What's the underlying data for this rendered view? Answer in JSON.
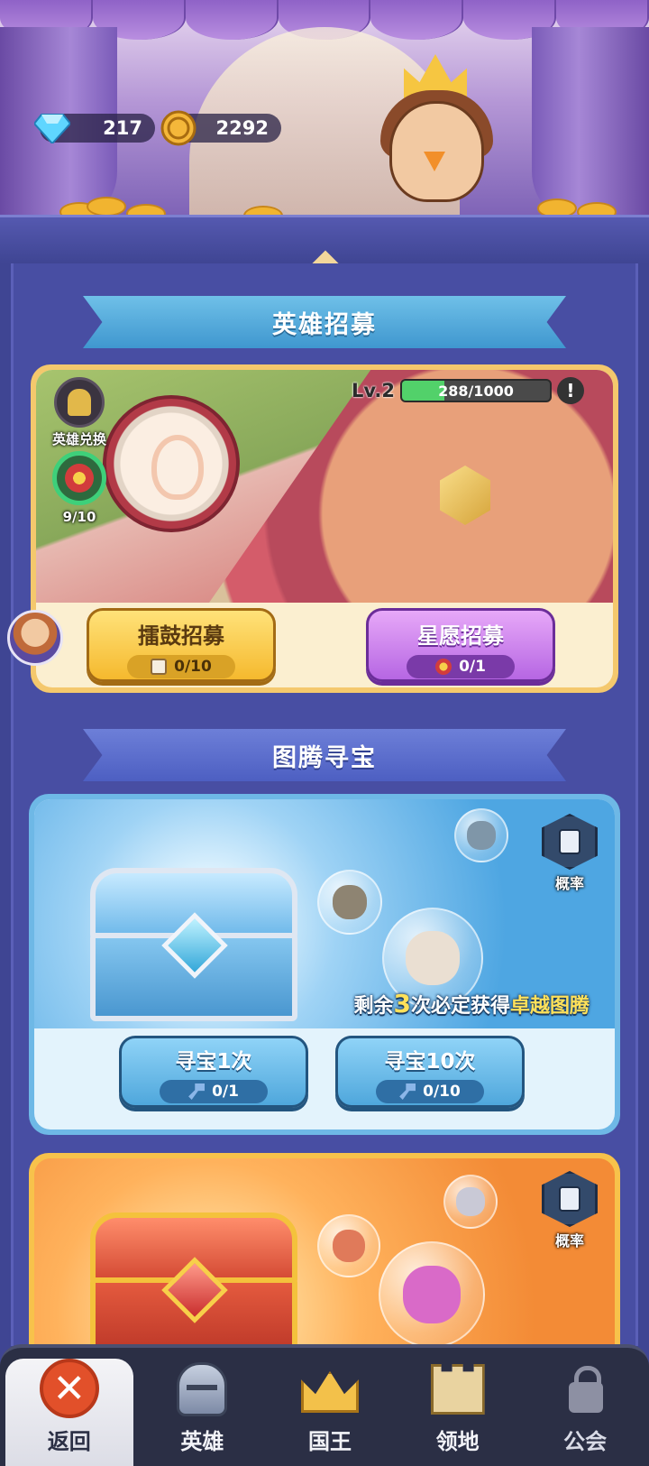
{
  "currencies": {
    "diamonds": "217",
    "gold": "2292"
  },
  "hero_recruit": {
    "section_title": "英雄招募",
    "exchange_label": "英雄兑换",
    "token_progress": "9/10",
    "level_label": "Lv.2",
    "exp_text": "288/1000",
    "exp_fraction": 0.288,
    "alert_icon": "!",
    "drum_button": {
      "label": "擂鼓招募",
      "count": "0/10"
    },
    "star_button": {
      "label": "星愿招募",
      "count": "0/1"
    }
  },
  "totem_hunt": {
    "section_title": "图腾寻宝",
    "rate_label": "概率",
    "guarantee": {
      "prefix": "剩余",
      "number": "3",
      "middle": "次必定获得",
      "highlight": "卓越图腾"
    },
    "hunt_once": {
      "label": "寻宝1次",
      "count": "0/1"
    },
    "hunt_ten": {
      "label": "寻宝10次",
      "count": "0/10"
    },
    "rate_label_2": "概率"
  },
  "bottom_nav": {
    "items": [
      {
        "label": "返回",
        "icon": "close-icon"
      },
      {
        "label": "英雄",
        "icon": "knight-helmet-icon"
      },
      {
        "label": "国王",
        "icon": "crown-icon"
      },
      {
        "label": "领地",
        "icon": "castle-icon"
      },
      {
        "label": "公会",
        "icon": "lock-icon"
      }
    ]
  },
  "colors": {
    "background": "#3f4593",
    "accent_blue": "#4fa7dc",
    "accent_yellow": "#f5b92e",
    "accent_purple": "#b666e3",
    "nav_bar": "#2b2f45"
  }
}
